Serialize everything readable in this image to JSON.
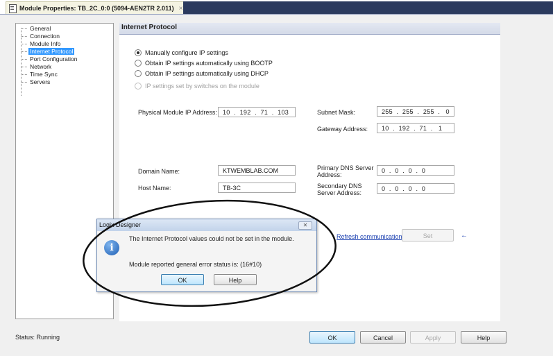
{
  "window": {
    "tab_title": "Module Properties: TB_2C_0:0 (5094-AEN2TR 2.011)",
    "tab_close": "×"
  },
  "tree": {
    "items": [
      {
        "label": "General",
        "selected": false
      },
      {
        "label": "Connection",
        "selected": false
      },
      {
        "label": "Module Info",
        "selected": false
      },
      {
        "label": "Internet Protocol",
        "selected": true
      },
      {
        "label": "Port Configuration",
        "selected": false
      },
      {
        "label": "Network",
        "selected": false
      },
      {
        "label": "Time Sync",
        "selected": false
      },
      {
        "label": "Servers",
        "selected": false
      }
    ]
  },
  "panel": {
    "header": "Internet Protocol",
    "radios": [
      {
        "label": "Manually configure IP settings",
        "checked": true,
        "enabled": true
      },
      {
        "label": "Obtain IP settings automatically using BOOTP",
        "checked": false,
        "enabled": true
      },
      {
        "label": "Obtain IP settings automatically using DHCP",
        "checked": false,
        "enabled": true
      },
      {
        "label": "IP settings set by switches on the module",
        "checked": false,
        "enabled": false
      }
    ],
    "ip_address": {
      "label": "Physical Module IP Address:",
      "value": "10  .  192  .  71  .  103"
    },
    "subnet_mask": {
      "label": "Subnet Mask:",
      "value": "255  .  255  .  255  .   0"
    },
    "gateway": {
      "label": "Gateway Address:",
      "value": "10  .  192  .  71  .   1"
    },
    "domain_name": {
      "label": "Domain Name:",
      "value": "KTWEMBLAB.COM"
    },
    "host_name": {
      "label": "Host Name:",
      "value": "TB-3C"
    },
    "primary_dns": {
      "label_line1": "Primary DNS Server",
      "label_line2": "Address:",
      "value": "0  .  0  .  0  .  0"
    },
    "secondary_dns": {
      "label_line1": "Secondary DNS",
      "label_line2": "Server Address:",
      "value": "0  .  0  .  0  .  0"
    },
    "refresh_link": "Refresh communication.",
    "set_button": "Set",
    "arrow_glyph": "←"
  },
  "status": {
    "text": "Status:  Running"
  },
  "footer_buttons": {
    "ok": "OK",
    "cancel": "Cancel",
    "apply": "Apply",
    "help": "Help"
  },
  "dialog": {
    "title": "Logix Designer",
    "close": "✕",
    "icon": "info-icon",
    "message": "The Internet Protocol values could not be set in the module.",
    "detail": "Module reported general error status is: (16#10)",
    "ok": "OK",
    "help": "Help"
  },
  "colors": {
    "selection": "#3399ff",
    "link": "#1a3fb0",
    "top_strip": "#2b3a5e",
    "info_icon": "#1f5fb4"
  }
}
